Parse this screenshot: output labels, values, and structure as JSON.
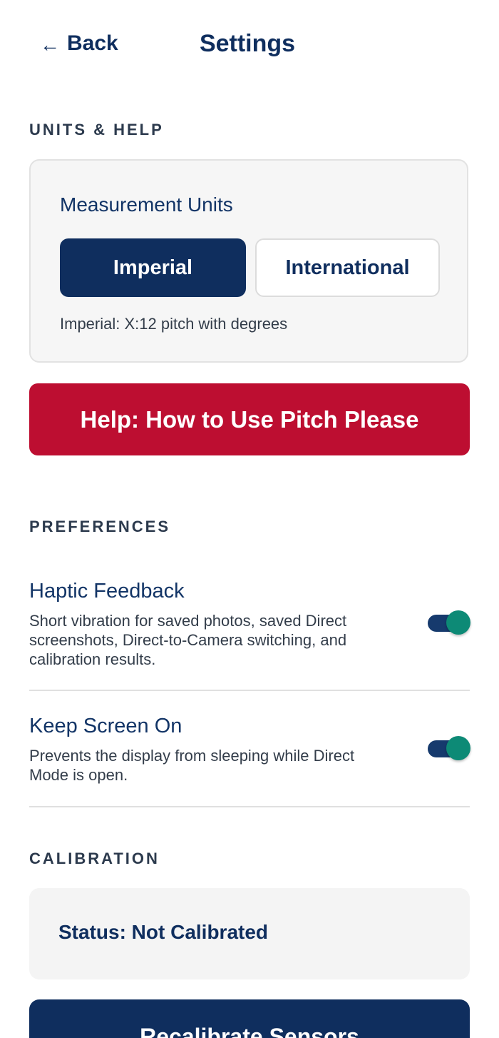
{
  "header": {
    "back_arrow": "←",
    "back_label": "Back",
    "title": "Settings"
  },
  "units_help": {
    "section_title": "UNITS & HELP",
    "card_title": "Measurement Units",
    "options": [
      "Imperial",
      "International"
    ],
    "selected": "Imperial",
    "hint": "Imperial: X:12 pitch with degrees",
    "help_button": "Help: How to Use Pitch Please"
  },
  "preferences": {
    "section_title": "PREFERENCES",
    "items": [
      {
        "title": "Haptic Feedback",
        "description": "Short vibration for saved photos, saved Direct screenshots, Direct-to-Camera switching, and calibration results.",
        "enabled": true
      },
      {
        "title": "Keep Screen On",
        "description": "Prevents the display from sleeping while Direct Mode is open.",
        "enabled": true
      }
    ]
  },
  "calibration": {
    "section_title": "CALIBRATION",
    "status": "Status: Not Calibrated",
    "recalibrate_button": "Recalibrate Sensors"
  },
  "colors": {
    "primary_navy": "#0f2e5e",
    "help_red": "#bd0e31",
    "toggle_knob": "#0d8a76",
    "card_background": "#f6f6f6"
  }
}
